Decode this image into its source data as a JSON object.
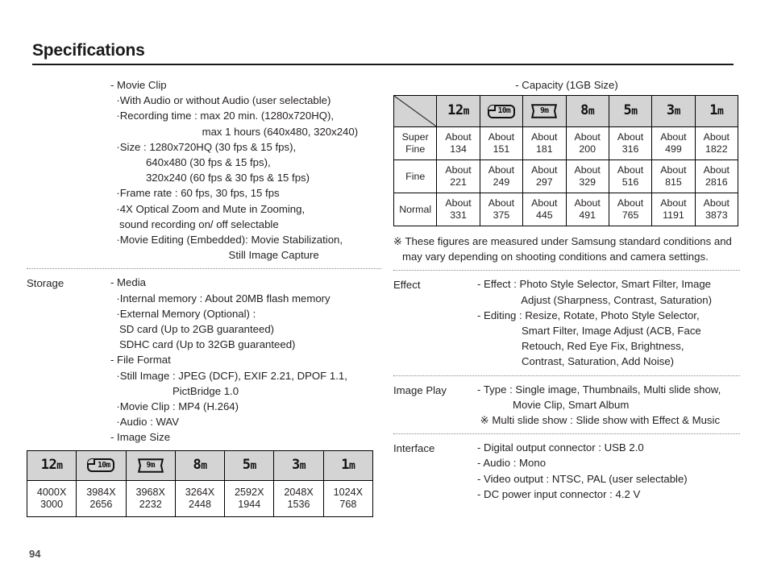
{
  "page": {
    "title": "Specifications",
    "number": "94"
  },
  "resolution_icons": [
    {
      "id": "12m",
      "kind": "plain",
      "label": "12",
      "unit": "m"
    },
    {
      "id": "10m",
      "kind": "boxed",
      "label": "10m"
    },
    {
      "id": "9m",
      "kind": "pano",
      "label": "9m"
    },
    {
      "id": "8m",
      "kind": "plain",
      "label": "8",
      "unit": "m"
    },
    {
      "id": "5m",
      "kind": "plain",
      "label": "5",
      "unit": "m"
    },
    {
      "id": "3m",
      "kind": "plain",
      "label": "3",
      "unit": "m"
    },
    {
      "id": "1m",
      "kind": "plain",
      "label": "1",
      "unit": "m"
    }
  ],
  "left_column": {
    "movie_clip": {
      "lines": [
        "- Movie Clip",
        "  ·With Audio or without Audio (user selectable)",
        "  ·Recording time : max 20 min. (1280x720HQ),",
        "                               max 1 hours (640x480, 320x240)",
        "  ·Size : 1280x720HQ (30 fps & 15 fps),",
        "            640x480 (30 fps & 15 fps),",
        "            320x240 (60 fps & 30 fps & 15 fps)",
        "  ·Frame rate : 60 fps, 30 fps, 15 fps",
        "  ·4X Optical Zoom and Mute in Zooming,",
        "   sound recording on/ off selectable",
        "  ·Movie Editing (Embedded): Movie Stabilization,",
        "                                        Still Image Capture"
      ]
    },
    "storage": {
      "label": "Storage",
      "lines": [
        "- Media",
        "  ·Internal memory : About 20MB flash memory",
        "  ·External Memory (Optional) :",
        "   SD card (Up to 2GB guaranteed)",
        "   SDHC card (Up to 32GB guaranteed)",
        "- File Format",
        "  ·Still Image : JPEG (DCF), EXIF 2.21, DPOF 1.1,",
        "                     PictBridge 1.0",
        "  ·Movie Clip : MP4 (H.264)",
        "  ·Audio : WAV",
        "- Image Size"
      ]
    },
    "image_size_table": {
      "headers": [
        "12m",
        "10m",
        "9m",
        "8m",
        "5m",
        "3m",
        "1m"
      ],
      "values": [
        "4000X\n3000",
        "3984X\n2656",
        "3968X\n2232",
        "3264X\n2448",
        "2592X\n1944",
        "2048X\n1536",
        "1024X\n768"
      ]
    }
  },
  "right_column": {
    "capacity": {
      "heading": "- Capacity (1GB Size)",
      "headers": [
        "12m",
        "10m",
        "9m",
        "8m",
        "5m",
        "3m",
        "1m"
      ],
      "rows": [
        {
          "quality": "Super\nFine",
          "values": [
            "About\n134",
            "About\n151",
            "About\n181",
            "About\n200",
            "About\n316",
            "About\n499",
            "About\n1822"
          ]
        },
        {
          "quality": "Fine",
          "values": [
            "About\n221",
            "About\n249",
            "About\n297",
            "About\n329",
            "About\n516",
            "About\n815",
            "About\n2816"
          ]
        },
        {
          "quality": "Normal",
          "values": [
            "About\n331",
            "About\n375",
            "About\n445",
            "About\n491",
            "About\n765",
            "About\n1191",
            "About\n3873"
          ]
        }
      ],
      "note": [
        "※ These figures are measured under Samsung standard conditions and",
        "   may vary depending on shooting conditions and camera settings."
      ]
    },
    "effect": {
      "label": "Effect",
      "lines": [
        "- Effect : Photo Style Selector, Smart Filter, Image",
        "               Adjust (Sharpness, Contrast, Saturation)",
        "- Editing : Resize, Rotate, Photo Style Selector,",
        "               Smart Filter, Image Adjust (ACB, Face",
        "               Retouch, Red Eye Fix, Brightness,",
        "               Contrast, Saturation, Add Noise)"
      ]
    },
    "image_play": {
      "label": "Image Play",
      "lines": [
        "- Type : Single image, Thumbnails, Multi slide show,",
        "            Movie Clip, Smart Album",
        " ※ Multi slide show : Slide show with Effect & Music"
      ]
    },
    "interface": {
      "label": "Interface",
      "lines": [
        "- Digital output connector : USB 2.0",
        "- Audio : Mono",
        "- Video output : NTSC, PAL (user selectable)",
        "- DC power input connector : 4.2 V"
      ]
    }
  }
}
